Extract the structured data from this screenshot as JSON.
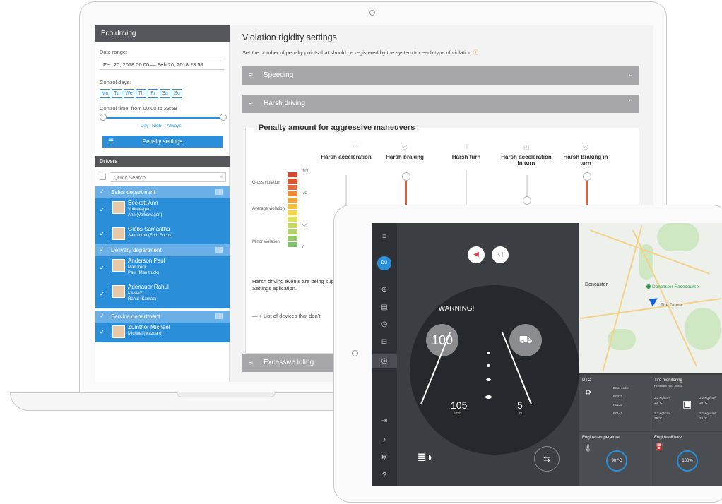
{
  "eco": {
    "title": "Eco driving",
    "date_range_label": "Date range:",
    "date_range_value": "Feb 20, 2018 00:00 — Feb 20, 2018 23:59",
    "control_days_label": "Control days:",
    "days": [
      "Mo",
      "Tu",
      "We",
      "Th",
      "Fr",
      "Sa",
      "Su"
    ],
    "control_time_label": "Control time: from 00:00 to 23:59",
    "time_modes": [
      "Day",
      "Night",
      "Always"
    ],
    "penalty_settings_btn": "Penalty settings",
    "drivers_header": "Drivers",
    "search_placeholder": "Quick Search",
    "departments": [
      {
        "name": "Sales department"
      },
      {
        "name": "Delivery department"
      },
      {
        "name": "Service department"
      }
    ],
    "drivers": [
      {
        "name": "Beckett Ann",
        "line1": "Volkswagen",
        "line2": "Ann (Volkswagen)"
      },
      {
        "name": "Gibbs Samantha",
        "line1": "Samantha (Ford Focus)",
        "line2": ""
      },
      {
        "name": "Anderson Paul",
        "line1": "Man truck",
        "line2": "Paul (Man truck)"
      },
      {
        "name": "Adenauer Rahul",
        "line1": "KAMAZ",
        "line2": "Rahul (Kamaz)"
      },
      {
        "name": "Zumthor Michael",
        "line1": "Michael (Mazda 6)",
        "line2": ""
      }
    ]
  },
  "settings": {
    "title": "Violation rigidity settings",
    "subtitle": "Set the number of penalty points that should be registered by the system for each type of violation",
    "sections": {
      "speeding": "Speeding",
      "harsh_driving": "Harsh driving",
      "idling": "Excessive idling"
    },
    "penalty_title": "Penalty amount for aggressive maneuvers",
    "scale_labels": {
      "gross": "Gross violation",
      "average": "Average violation",
      "minor": "Minor violation"
    },
    "scale_values": [
      "100",
      "70",
      "30",
      "0"
    ],
    "columns": [
      "Harsh acceleration",
      "Harsh braking",
      "Harsh turn",
      "Harsh acceleration in turn",
      "Harsh braking in turn"
    ],
    "info_text": "Harsh driving events are being support some types of events, Settings aplication.",
    "devices_text": "— +  List of devices that don't"
  },
  "tablet": {
    "nav_user": "DU",
    "warning": "WARNING!",
    "speed_limit": "100",
    "speed": "105",
    "speed_unit": "km/h",
    "distance": "5",
    "distance_unit": "m",
    "map_labels": {
      "town": "Doncaster",
      "racecourse": "Doncaster Racecourse",
      "dome": "The Dome"
    },
    "dtc": {
      "title": "DTC",
      "header": "Error codes",
      "codes": [
        "P0325",
        "P0135",
        "P0141"
      ]
    },
    "tire": {
      "title": "Tire monitoring",
      "subtitle": "Pressure and Temp",
      "values": [
        "2.2 Kgf/cm²",
        "2.2 Kgf/cm²",
        "2.1 Kgf/cm²",
        "2.1 Kgf/cm²"
      ],
      "temps": [
        "30 °C",
        "30 °C",
        "29 °C",
        "29 °C"
      ]
    },
    "engine_temp": {
      "title": "Engine temperature",
      "value": "90 °C"
    },
    "oil": {
      "title": "Engine oil level",
      "value": "100%"
    }
  },
  "colors": {
    "accent": "#2a8fd8",
    "header": "#55575b",
    "accordion": "#a7a7a9",
    "red": "#e35b3d"
  }
}
